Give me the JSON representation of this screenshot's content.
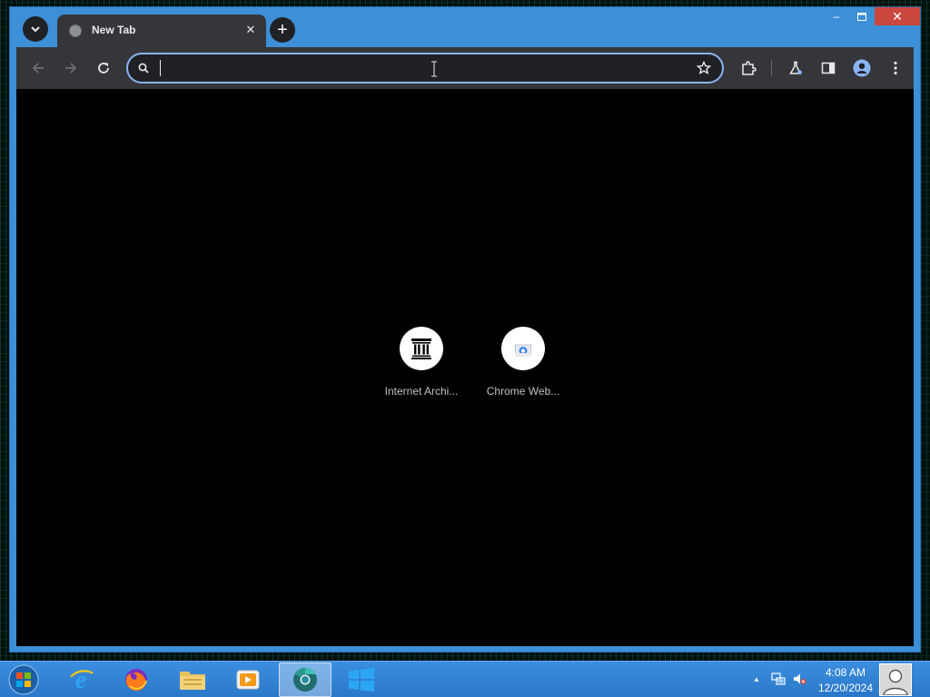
{
  "browser": {
    "tab": {
      "title": "New Tab",
      "close_glyph": "✕",
      "favicon": "globe-icon"
    },
    "tab_search_icon": "chevron-down-icon",
    "new_tab_glyph": "+",
    "window_controls": {
      "minimize_glyph": "–",
      "maximize_glyph": "▫",
      "close_glyph": "✕"
    },
    "toolbar": {
      "back_icon": "arrow-left-icon",
      "forward_icon": "arrow-right-icon",
      "reload_icon": "reload-icon",
      "omnibox_value": "",
      "omnibox_search_icon": "search-icon",
      "bookmark_icon": "star-icon",
      "extensions_icon": "puzzle-icon",
      "labs_icon": "flask-icon",
      "side_panel_icon": "side-panel-icon",
      "profile_icon": "avatar-icon",
      "menu_icon": "kebab-menu-icon"
    },
    "shortcuts": [
      {
        "label": "Internet Archi...",
        "icon": "archive-building-icon"
      },
      {
        "label": "Chrome Web...",
        "icon": "chrome-web-store-icon"
      }
    ],
    "colors": {
      "frame": "#3d8fd8",
      "toolbar": "#35363a",
      "omnibox_focus": "#8ab4f8",
      "content_bg": "#000000"
    }
  },
  "taskbar": {
    "start_icon": "windows-orb-icon",
    "apps": [
      {
        "name": "internet-explorer-icon"
      },
      {
        "name": "firefox-icon"
      },
      {
        "name": "file-explorer-icon"
      },
      {
        "name": "media-player-icon"
      },
      {
        "name": "chrome-browser-icon",
        "active": true
      },
      {
        "name": "windows-logo-icon"
      }
    ],
    "tray": {
      "show_hidden_glyph": "▲",
      "network_icon": "network-icon",
      "volume_icon": "volume-muted-icon"
    },
    "clock": {
      "time": "4:08 AM",
      "date": "12/20/2024"
    },
    "user_icon": "user-tile-icon"
  }
}
